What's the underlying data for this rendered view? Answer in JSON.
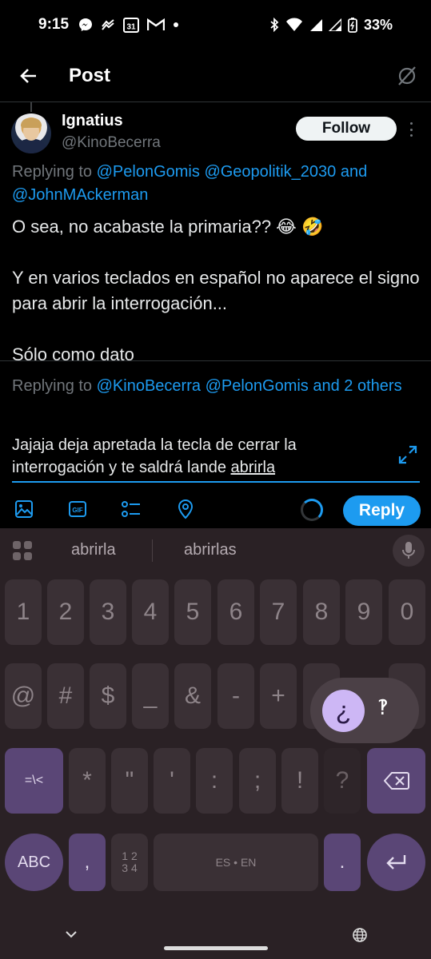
{
  "status_bar": {
    "time": "9:15",
    "calendar_day": "31",
    "battery": "33%",
    "left_icons": [
      "messenger-icon",
      "link-icon",
      "calendar-icon",
      "gmail-icon",
      "dot-icon"
    ],
    "right_icons": [
      "bluetooth-icon",
      "wifi-icon",
      "signal-icon",
      "signal-icon",
      "battery-icon"
    ]
  },
  "header": {
    "title": "Post"
  },
  "tweet": {
    "author_name": "Ignatius",
    "author_handle": "@KinoBecerra",
    "follow_label": "Follow",
    "replying_prefix": "Replying to",
    "replying_mentions": [
      "@PelonGomis",
      "@Geopolitik_2030",
      "and",
      "@JohnMAckerman"
    ],
    "text": "O sea, no acabaste la primaria?? 😂 🤣\n\nY en varios teclados en español no aparece el signo para abrir la interrogación...\n\nSólo como dato"
  },
  "compose": {
    "replying_prefix": "Replying to",
    "replying_mentions": [
      "@KinoBecerra",
      "@PelonGomis",
      "and 2 others"
    ],
    "text_before": "Jajaja deja  apretada la tecla de cerrar la interrogación y te saldrá lande ",
    "text_underlined": "abrirla",
    "reply_label": "Reply",
    "toolbar_icons": [
      "image-icon",
      "gif-icon",
      "poll-icon",
      "location-icon"
    ]
  },
  "keyboard": {
    "suggestions": [
      "abrirla",
      "abrirlas"
    ],
    "row_numbers": [
      "1",
      "2",
      "3",
      "4",
      "5",
      "6",
      "7",
      "8",
      "9",
      "0"
    ],
    "row_symbols1": [
      "@",
      "#",
      "$",
      "_",
      "&",
      "-",
      "+"
    ],
    "row_symbols2_left": "=\\<",
    "row_symbols2": [
      "*",
      "\"",
      "'",
      ":",
      ";",
      "!",
      "?"
    ],
    "row_bottom": {
      "abc": "ABC",
      "comma": ",",
      "numpad_top": "1 2",
      "numpad_bottom": "3 4",
      "space": "ES • EN",
      "period": "."
    },
    "popup": {
      "selected": "¿",
      "alternate": "‽"
    }
  },
  "colors": {
    "accent": "#1d9bf0",
    "keyboard_bg": "#2a2125",
    "key_bg": "#3a3035",
    "purple_key": "#5a4676",
    "popup_selected": "#cdb7f5"
  }
}
